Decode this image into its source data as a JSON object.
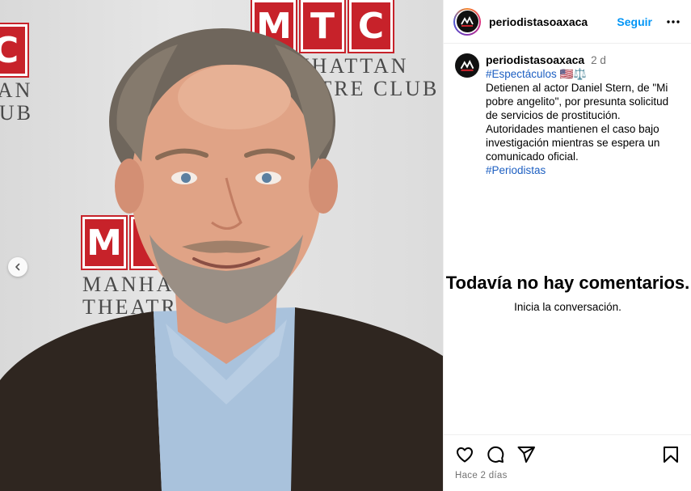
{
  "media": {
    "backdrop": {
      "logo_text": "MTC",
      "line1": "MANHATTAN",
      "line2": "THEATRE CLUB"
    },
    "prev_icon": "chevron-left-icon"
  },
  "header": {
    "username": "periodistasoaxaca",
    "follow_label": "Seguir",
    "more_icon": "more-horizontal-icon"
  },
  "caption": {
    "username": "periodistasoaxaca",
    "time": "2 d",
    "hashtag_1": "#Espectáculos",
    "emoji": "🇺🇸⚖️",
    "text": "Detienen al actor Daniel Stern, de \"Mi pobre angelito\", por presunta solicitud de servicios de prostitución. Autoridades mantienen el caso bajo investigación mientras se espera un comunicado oficial.",
    "hashtag_2": "#Periodistas"
  },
  "comments": {
    "empty_title": "Todavía no hay comentarios.",
    "empty_sub": "Inicia la conversación."
  },
  "actions": {
    "icons": [
      "heart-icon",
      "comment-icon",
      "share-icon",
      "bookmark-icon"
    ],
    "timestamp": "Hace 2 días"
  },
  "colors": {
    "accent": "#0095f6",
    "hashtag": "#1d5fc2",
    "brand_red": "#c7222a",
    "muted": "#737373"
  }
}
